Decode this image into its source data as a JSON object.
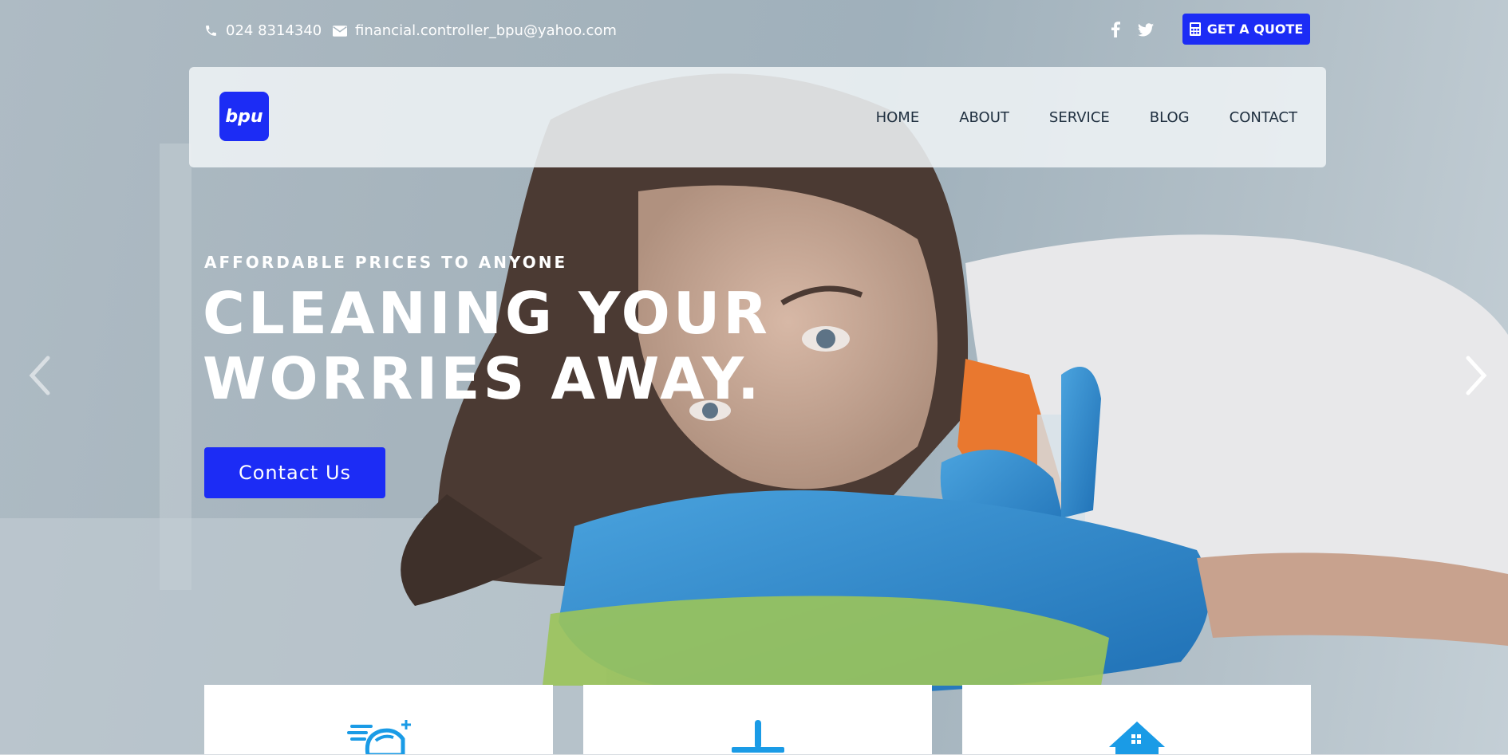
{
  "topbar": {
    "phone": "024 8314340",
    "email": "financial.controller_bpu@yahoo.com",
    "quote_label": "GET A QUOTE",
    "social": [
      "facebook-icon",
      "twitter-icon"
    ]
  },
  "brand": {
    "logo_text": "bpu",
    "accent": "#1c2cf5"
  },
  "nav": {
    "items": [
      {
        "label": "HOME"
      },
      {
        "label": "ABOUT"
      },
      {
        "label": "SERVICE"
      },
      {
        "label": "BLOG"
      },
      {
        "label": "CONTACT"
      }
    ]
  },
  "hero": {
    "tagline": "AFFORDABLE PRICES TO ANYONE",
    "headline_line1": "CLEANING YOUR",
    "headline_line2": "WORRIES AWAY.",
    "cta_label": "Contact Us"
  },
  "carousel": {
    "prev_icon": "chevron-left-icon",
    "next_icon": "chevron-right-icon"
  },
  "services": [
    {
      "icon": "hand-wash-icon",
      "icon_color": "#1a9be6"
    },
    {
      "icon": "squeegee-icon",
      "icon_color": "#1a9be6"
    },
    {
      "icon": "house-icon",
      "icon_color": "#1a9be6"
    }
  ]
}
